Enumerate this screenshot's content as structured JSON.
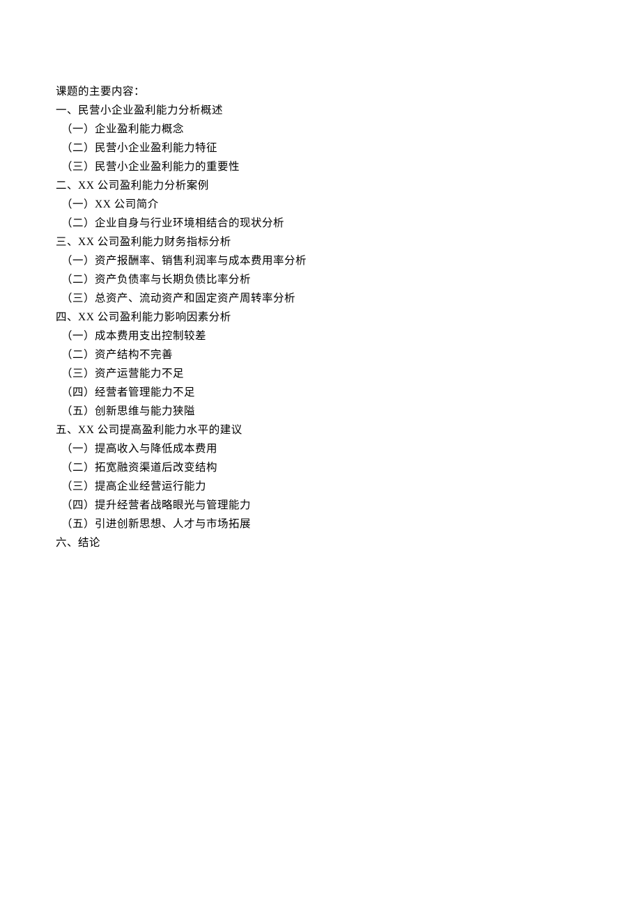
{
  "title": "课题的主要内容：",
  "sections": [
    {
      "heading": "一、民营小企业盈利能力分析概述",
      "items": [
        "（一）企业盈利能力概念",
        "（二）民营小企业盈利能力特征",
        "（三）民营小企业盈利能力的重要性"
      ]
    },
    {
      "heading": "二、XX 公司盈利能力分析案例",
      "items": [
        "（一）XX 公司简介",
        "（二）企业自身与行业环境相结合的现状分析"
      ]
    },
    {
      "heading": "三、XX 公司盈利能力财务指标分析",
      "items": [
        "（一）资产报酬率、销售利润率与成本费用率分析",
        "（二）资产负债率与长期负债比率分析",
        "（三）总资产、流动资产和固定资产周转率分析"
      ]
    },
    {
      "heading": "四、XX 公司盈利能力影响因素分析",
      "items": [
        "（一）成本费用支出控制较差",
        "（二）资产结构不完善",
        "（三）资产运营能力不足",
        "（四）经营者管理能力不足",
        "（五）创新思维与能力狭隘"
      ]
    },
    {
      "heading": "五、XX 公司提高盈利能力水平的建议",
      "items": [
        "（一）提高收入与降低成本费用",
        "（二）拓宽融资渠道后改变结构",
        "（三）提高企业经营运行能力",
        "（四）提升经营者战略眼光与管理能力",
        "（五）引进创新思想、人才与市场拓展"
      ]
    },
    {
      "heading": "六、结论",
      "items": []
    }
  ]
}
